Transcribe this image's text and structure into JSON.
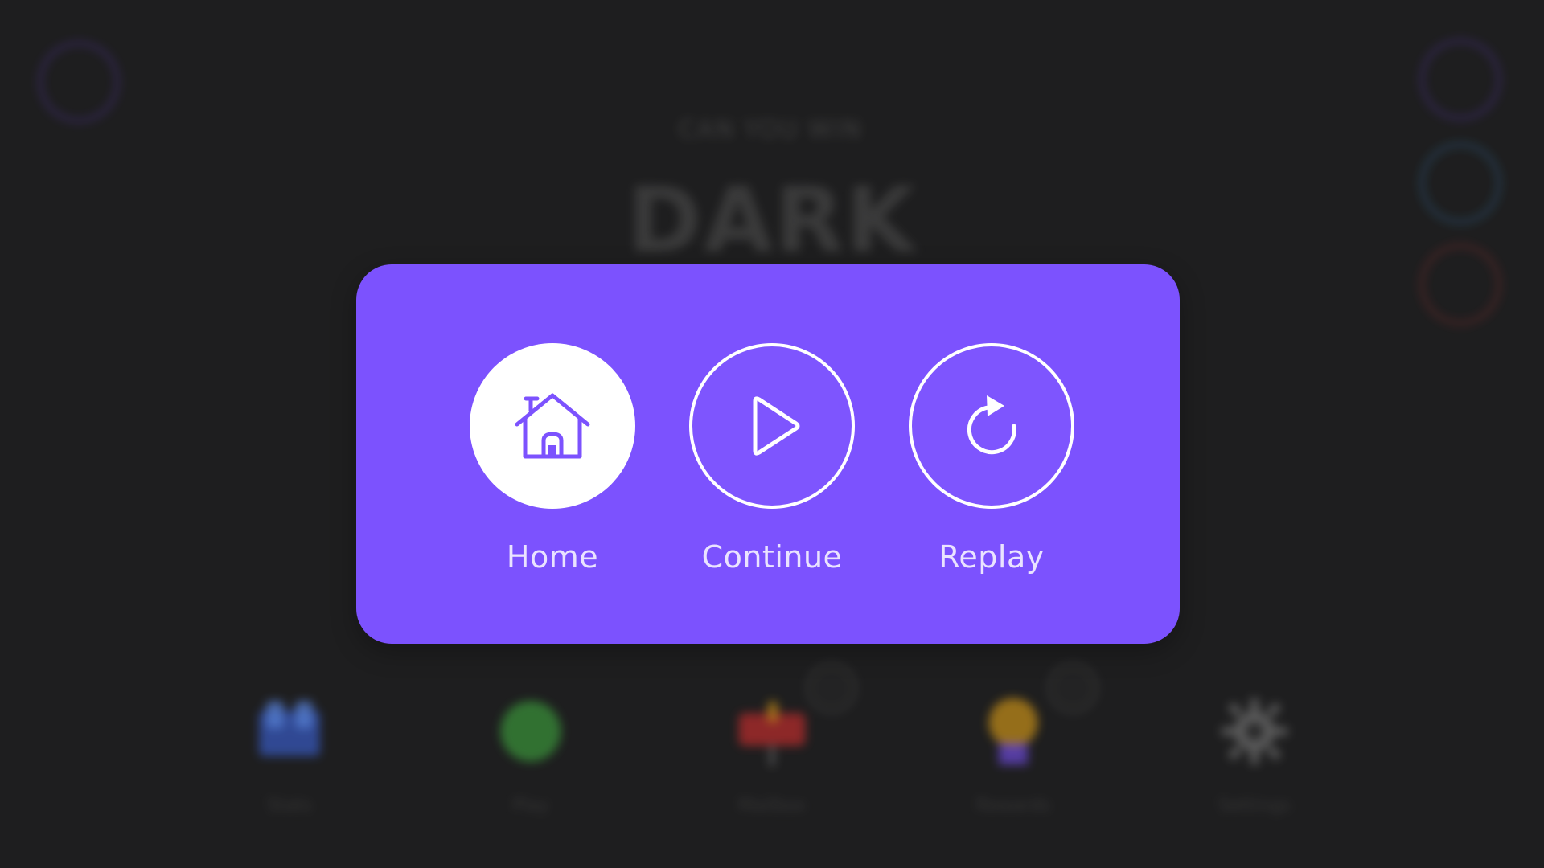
{
  "background": {
    "title_small": "CAN YOU WIN",
    "title_big": "DARK",
    "menu_items": [
      {
        "label": "Stats",
        "icon": "building-icon",
        "color": "#3b63d8"
      },
      {
        "label": "Play",
        "icon": "green-orb-icon",
        "color": "#3ea33e"
      },
      {
        "label": "Mailbox",
        "icon": "mailbox-icon",
        "color": "#cf2f2f"
      },
      {
        "label": "Rewards",
        "icon": "medal-icon",
        "color": "#d69a1a"
      },
      {
        "label": "Settings",
        "icon": "gear-icon",
        "color": "#7a7a7a"
      }
    ],
    "side_icons": [
      {
        "name": "profile-icon",
        "color": "#6b45d8"
      },
      {
        "name": "twitter-icon",
        "color": "#3ea7f0"
      },
      {
        "name": "pinterest-icon",
        "color": "#d43b3b"
      }
    ]
  },
  "pause_menu": {
    "actions": [
      {
        "label": "Home",
        "icon": "home-icon"
      },
      {
        "label": "Continue",
        "icon": "play-icon"
      },
      {
        "label": "Replay",
        "icon": "replay-icon"
      }
    ]
  },
  "theme": {
    "panel": "#7c52fe",
    "background": "#1f1f20",
    "white": "#ffffff"
  }
}
